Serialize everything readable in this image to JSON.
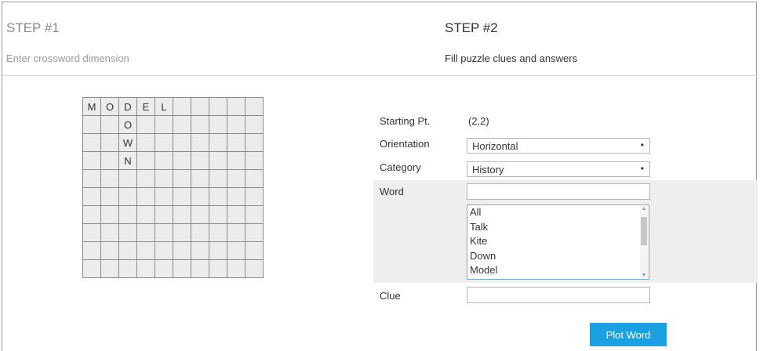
{
  "step1": {
    "title": "STEP #1",
    "subtitle": "Enter crossword dimension",
    "grid": [
      [
        "M",
        "O",
        "D",
        "E",
        "L",
        "",
        "",
        "",
        "",
        ""
      ],
      [
        "",
        "",
        "O",
        "",
        "",
        "",
        "",
        "",
        "",
        ""
      ],
      [
        "",
        "",
        "W",
        "",
        "",
        "",
        "",
        "",
        "",
        ""
      ],
      [
        "",
        "",
        "N",
        "",
        "",
        "",
        "",
        "",
        "",
        ""
      ],
      [
        "",
        "",
        "",
        "",
        "",
        "",
        "",
        "",
        "",
        ""
      ],
      [
        "",
        "",
        "",
        "",
        "",
        "",
        "",
        "",
        "",
        ""
      ],
      [
        "",
        "",
        "",
        "",
        "",
        "",
        "",
        "",
        "",
        ""
      ],
      [
        "",
        "",
        "",
        "",
        "",
        "",
        "",
        "",
        "",
        ""
      ],
      [
        "",
        "",
        "",
        "",
        "",
        "",
        "",
        "",
        "",
        ""
      ],
      [
        "",
        "",
        "",
        "",
        "",
        "",
        "",
        "",
        "",
        ""
      ]
    ]
  },
  "step2": {
    "title": "STEP #2",
    "subtitle": "Fill puzzle clues and answers",
    "starting_pt_label": "Starting Pt.",
    "starting_pt_value": "(2,2)",
    "orientation_label": "Orientation",
    "orientation_value": "Horizontal",
    "category_label": "Category",
    "category_value": "History",
    "word_label": "Word",
    "word_value": "",
    "word_options": [
      "All",
      "Talk",
      "Kite",
      "Down",
      "Model"
    ],
    "clue_label": "Clue",
    "clue_value": "",
    "plot_button_label": "Plot Word"
  },
  "colors": {
    "accent_button": "#1ba0e2",
    "panel_bg": "#eeeeee",
    "grid_bg": "#ececec"
  },
  "icons": {
    "dropdown": "chevron-down-icon"
  }
}
